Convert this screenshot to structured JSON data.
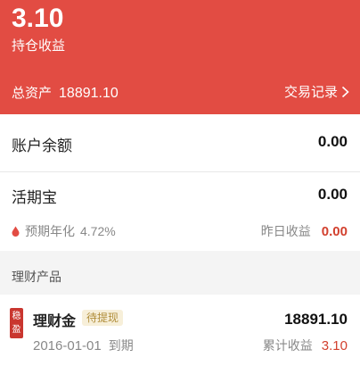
{
  "header": {
    "holding_profit": "3.10",
    "holding_profit_label": "持仓收益",
    "total_assets_label": "总资产",
    "total_assets_value": "18891.10",
    "records_label": "交易记录"
  },
  "account_balance": {
    "label": "账户余额",
    "value": "0.00"
  },
  "huoqibao": {
    "label": "活期宝",
    "value": "0.00",
    "expected_rate_label": "预期年化",
    "expected_rate_value": "4.72%",
    "yesterday_label": "昨日收益",
    "yesterday_value": "0.00"
  },
  "section": {
    "title": "理财产品"
  },
  "product": {
    "stamp_char_1": "稳",
    "stamp_char_2": "盈",
    "name": "理财金",
    "status": "待提现",
    "value": "18891.10",
    "date": "2016-01-01",
    "date_suffix": "到期",
    "cumulative_label": "累计收益",
    "cumulative_value": "3.10"
  },
  "colors": {
    "header_bg": "#e24c43",
    "accent_red": "#d2402e",
    "status_gold": "#b08d3a"
  },
  "icons": {
    "records_chevron": "chevron-right-icon",
    "rate_drop": "drop-icon"
  }
}
